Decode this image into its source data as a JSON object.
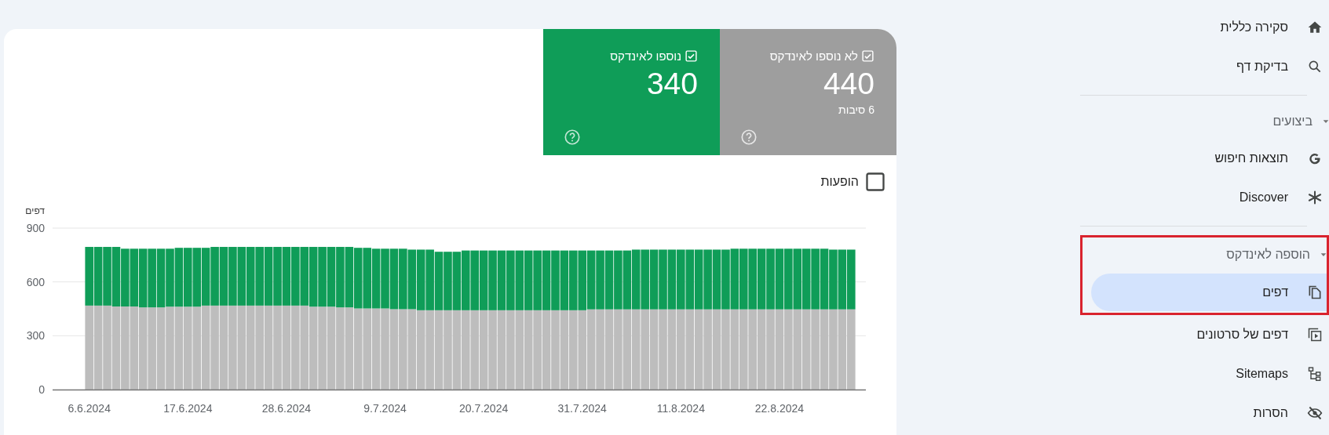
{
  "main": {
    "metrics": [
      {
        "label": "לא נוספו לאינדקס",
        "value": "440",
        "subtitle": "6 סיבות",
        "checked": true,
        "color": "#9e9e9e"
      },
      {
        "label": "נוספו לאינדקס",
        "value": "340",
        "checked": true,
        "color": "#0f9d58"
      }
    ],
    "impressions_toggle": {
      "label": "הופעות",
      "checked": false
    },
    "chart_data": {
      "type": "bar",
      "stacked": true,
      "ylabel": "דפים",
      "ylim": [
        0,
        900
      ],
      "yticks": [
        0,
        300,
        600,
        900
      ],
      "categories": [
        "6.6.2024",
        null,
        null,
        null,
        null,
        null,
        null,
        null,
        null,
        null,
        null,
        "17.6.2024",
        null,
        null,
        null,
        null,
        null,
        null,
        null,
        null,
        null,
        null,
        "28.6.2024",
        null,
        null,
        null,
        null,
        null,
        null,
        null,
        null,
        null,
        null,
        "9.7.2024",
        null,
        null,
        null,
        null,
        null,
        null,
        null,
        null,
        null,
        null,
        "20.7.2024",
        null,
        null,
        null,
        null,
        null,
        null,
        null,
        null,
        null,
        null,
        "31.7.2024",
        null,
        null,
        null,
        null,
        null,
        null,
        null,
        null,
        null,
        null,
        "11.8.2024",
        null,
        null,
        null,
        null,
        null,
        null,
        null,
        null,
        null,
        null,
        "22.8.2024",
        null,
        null,
        null,
        null,
        null,
        null,
        null,
        null
      ],
      "series": [
        {
          "color": "#bdbdbd",
          "values": [
            468,
            468,
            468,
            463,
            463,
            463,
            458,
            458,
            458,
            462,
            462,
            462,
            462,
            468,
            468,
            468,
            468,
            468,
            468,
            468,
            468,
            468,
            468,
            468,
            468,
            462,
            462,
            462,
            458,
            458,
            452,
            452,
            452,
            452,
            448,
            448,
            448,
            442,
            442,
            442,
            442,
            442,
            442,
            442,
            442,
            442,
            442,
            442,
            442,
            442,
            442,
            442,
            442,
            442,
            442,
            442,
            447,
            447,
            447,
            447,
            447,
            447,
            447,
            447,
            447,
            447,
            447,
            447,
            447,
            447,
            447,
            447,
            447,
            447,
            447,
            447,
            447,
            447,
            447,
            447,
            447,
            447,
            447,
            447,
            447,
            447
          ]
        },
        {
          "color": "#0f9d58",
          "values": [
            327,
            327,
            327,
            332,
            322,
            322,
            327,
            327,
            327,
            323,
            328,
            328,
            328,
            322,
            327,
            327,
            327,
            327,
            327,
            327,
            327,
            327,
            327,
            327,
            327,
            333,
            333,
            333,
            337,
            337,
            338,
            338,
            333,
            333,
            337,
            337,
            332,
            338,
            338,
            326,
            326,
            326,
            333,
            333,
            333,
            333,
            333,
            333,
            333,
            333,
            333,
            333,
            333,
            333,
            333,
            333,
            328,
            328,
            328,
            328,
            328,
            333,
            333,
            333,
            333,
            333,
            333,
            333,
            333,
            333,
            333,
            333,
            338,
            338,
            338,
            338,
            338,
            338,
            338,
            338,
            338,
            338,
            338,
            333,
            333,
            333
          ]
        }
      ]
    }
  },
  "sidebar": {
    "groups": [
      {
        "items": [
          {
            "label": "סקירה כללית",
            "selected": false
          },
          {
            "label": "בדיקת דף",
            "selected": false
          }
        ]
      },
      {
        "title": "ביצועים",
        "expanded": true,
        "items": [
          {
            "label": "תוצאות חיפוש",
            "selected": false
          },
          {
            "label": "Discover",
            "selected": false
          }
        ]
      },
      {
        "title": "הוספה לאינדקס",
        "expanded": true,
        "outlined": true,
        "items": [
          {
            "label": "דפים",
            "selected": true,
            "outlined": true
          },
          {
            "label": "דפים של סרטונים",
            "selected": false,
            "outlined": false
          },
          {
            "label": "Sitemaps",
            "selected": false,
            "outlined": false
          },
          {
            "label": "הסרות",
            "selected": false,
            "outlined": false
          }
        ]
      }
    ]
  }
}
